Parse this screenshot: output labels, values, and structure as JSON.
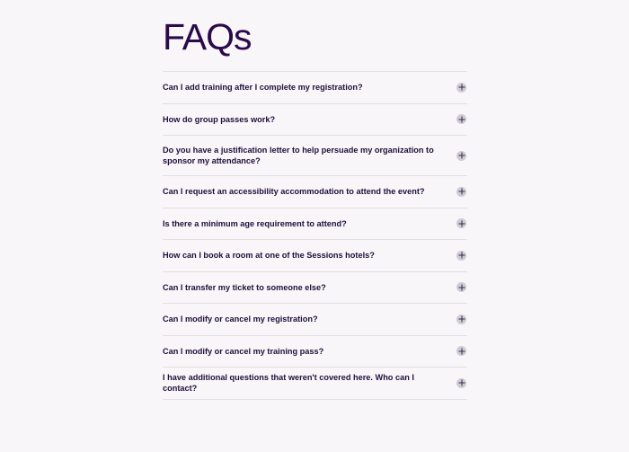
{
  "page": {
    "title": "FAQs"
  },
  "faqs": [
    {
      "question": "Can I add training after I complete my registration?",
      "icon": "plus-icon"
    },
    {
      "question": "How do group passes work?",
      "icon": "plus-icon"
    },
    {
      "question": "Do you have a justification letter to help persuade my organization to sponsor my attendance?",
      "icon": "plus-icon"
    },
    {
      "question": "Can I request an accessibility accommodation to attend the event?",
      "icon": "plus-icon"
    },
    {
      "question": "Is there a minimum age requirement to attend?",
      "icon": "plus-icon"
    },
    {
      "question": "How can I book a room at one of the Sessions hotels?",
      "icon": "plus-icon"
    },
    {
      "question": "Can I transfer my ticket to someone else?",
      "icon": "plus-icon"
    },
    {
      "question": "Can I modify or cancel my registration?",
      "icon": "plus-icon"
    },
    {
      "question": "Can I modify or cancel my training pass?",
      "icon": "plus-icon"
    },
    {
      "question": "I have additional questions that weren't covered here. Who can I contact?",
      "icon": "plus-icon"
    }
  ],
  "colors": {
    "background": "#f8f6f8",
    "title": "#2a0a4a",
    "text": "#1f0f3d",
    "divider": "#e2dfe4",
    "icon_bg": "#cfcbd3"
  }
}
